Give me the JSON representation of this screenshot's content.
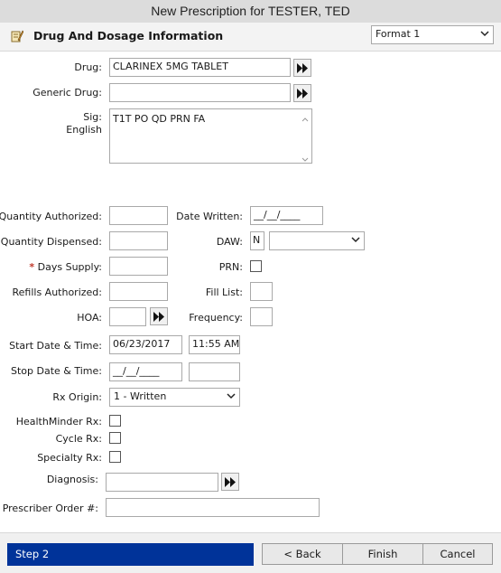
{
  "window": {
    "title": "New Prescription for TESTER, TED"
  },
  "header": {
    "title": "Drug And Dosage Information",
    "icon": "prescription-pencil-icon",
    "format_select": "Format 1"
  },
  "labels": {
    "drug": "Drug:",
    "generic_drug": "Generic Drug:",
    "sig": "Sig:",
    "sig_language": "English",
    "quantity_authorized": "Quantity Authorized:",
    "date_written": "Date Written:",
    "quantity_dispensed": "Quantity Dispensed:",
    "daw": "DAW:",
    "days_supply": "Days Supply:",
    "prn": "PRN:",
    "refills_authorized": "Refills Authorized:",
    "fill_list": "Fill List:",
    "hoa": "HOA:",
    "frequency": "Frequency:",
    "start_date_time": "Start Date & Time:",
    "stop_date_time": "Stop Date & Time:",
    "rx_origin": "Rx Origin:",
    "healthminder_rx": "HealthMinder Rx:",
    "cycle_rx": "Cycle Rx:",
    "specialty_rx": "Specialty Rx:",
    "diagnosis": "Diagnosis:",
    "prescriber_order": "Prescriber Order #:",
    "required_marker": "*"
  },
  "values": {
    "drug": "CLARINEX 5MG TABLET",
    "generic_drug": "",
    "sig": "T1T PO QD PRN FA",
    "quantity_authorized": "",
    "date_written": "__/__/____",
    "quantity_dispensed": "",
    "daw_code": "N",
    "daw_select": "",
    "days_supply": "",
    "prn_checked": false,
    "refills_authorized": "",
    "fill_list": "",
    "hoa": "",
    "frequency": "",
    "start_date": "06/23/2017",
    "start_time": "11:55 AM",
    "stop_date": "__/__/____",
    "stop_time": "",
    "rx_origin": "1 - Written",
    "healthminder_rx": false,
    "cycle_rx": false,
    "specialty_rx": false,
    "diagnosis": "",
    "prescriber_order": ""
  },
  "footer": {
    "step": "Step 2",
    "back": "< Back",
    "finish": "Finish",
    "cancel": "Cancel"
  },
  "colors": {
    "step_bg": "#003399",
    "required": "#c0392b",
    "titlebar_bg": "#dcdcdc"
  }
}
